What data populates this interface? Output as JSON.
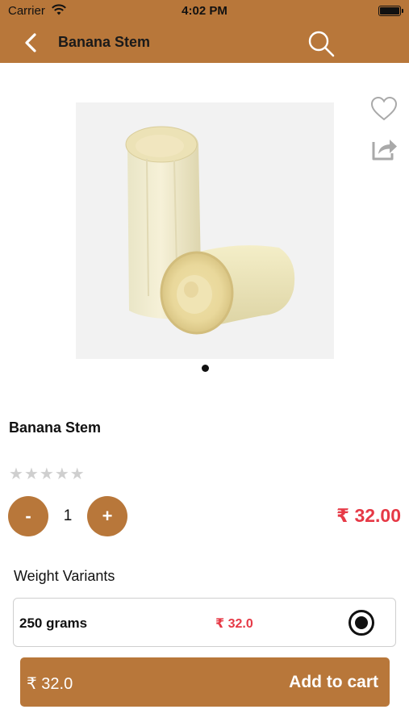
{
  "status_bar": {
    "carrier": "Carrier",
    "time": "4:02 PM",
    "wifi_icon": "wifi-icon",
    "battery_icon": "battery-icon"
  },
  "header": {
    "title": "Banana Stem",
    "back_icon": "back-chevron-icon",
    "search_icon": "search-icon",
    "background": "#b8773a"
  },
  "gallery": {
    "image_description_icon": "product-photo",
    "page_count": 1,
    "current_page": 1
  },
  "actions": {
    "favorite_icon": "heart-outline-icon",
    "share_icon": "share-icon"
  },
  "product": {
    "name": "Banana Stem",
    "rating": 0,
    "rating_max": 5,
    "price": "₹ 32.00"
  },
  "quantity": {
    "minus_label": "-",
    "value": "1",
    "plus_label": "+"
  },
  "variants": {
    "title": "Weight Variants",
    "items": [
      {
        "name": "250 grams",
        "price": "₹ 32.0",
        "selected": true
      }
    ]
  },
  "cart": {
    "total": "₹ 32.0",
    "add_label": "Add to cart"
  },
  "colors": {
    "accent": "#b8773a",
    "price": "#e63946",
    "star_empty": "#cfcfcf"
  }
}
